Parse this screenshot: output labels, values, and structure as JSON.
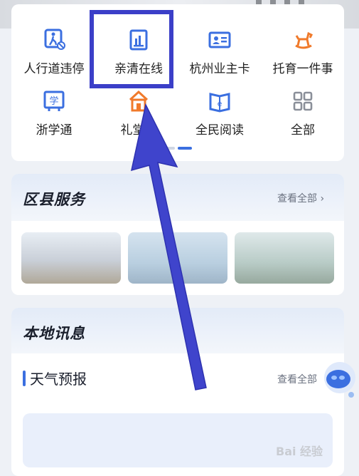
{
  "services": {
    "items": [
      {
        "label": "人行道违停",
        "icon": "pedestrian-icon"
      },
      {
        "label": "亲清在线",
        "icon": "building-chart-icon"
      },
      {
        "label": "杭州业主卡",
        "icon": "id-card-icon"
      },
      {
        "label": "托育一件事",
        "icon": "rocking-horse-icon"
      },
      {
        "label": "浙学通",
        "icon": "study-icon"
      },
      {
        "label": "礼堂家",
        "icon": "hall-icon"
      },
      {
        "label": "全民阅读",
        "icon": "book-icon"
      },
      {
        "label": "全部",
        "icon": "grid-icon"
      }
    ]
  },
  "district": {
    "title": "区县服务",
    "see_all": "查看全部 ›"
  },
  "local": {
    "title": "本地讯息",
    "weather_title": "天气预报",
    "see_all": "查看全部"
  },
  "watermark": "Bai 经验",
  "colors": {
    "accent": "#3b6fe0",
    "highlight": "#3b3fc8",
    "orange": "#f07a2b"
  }
}
